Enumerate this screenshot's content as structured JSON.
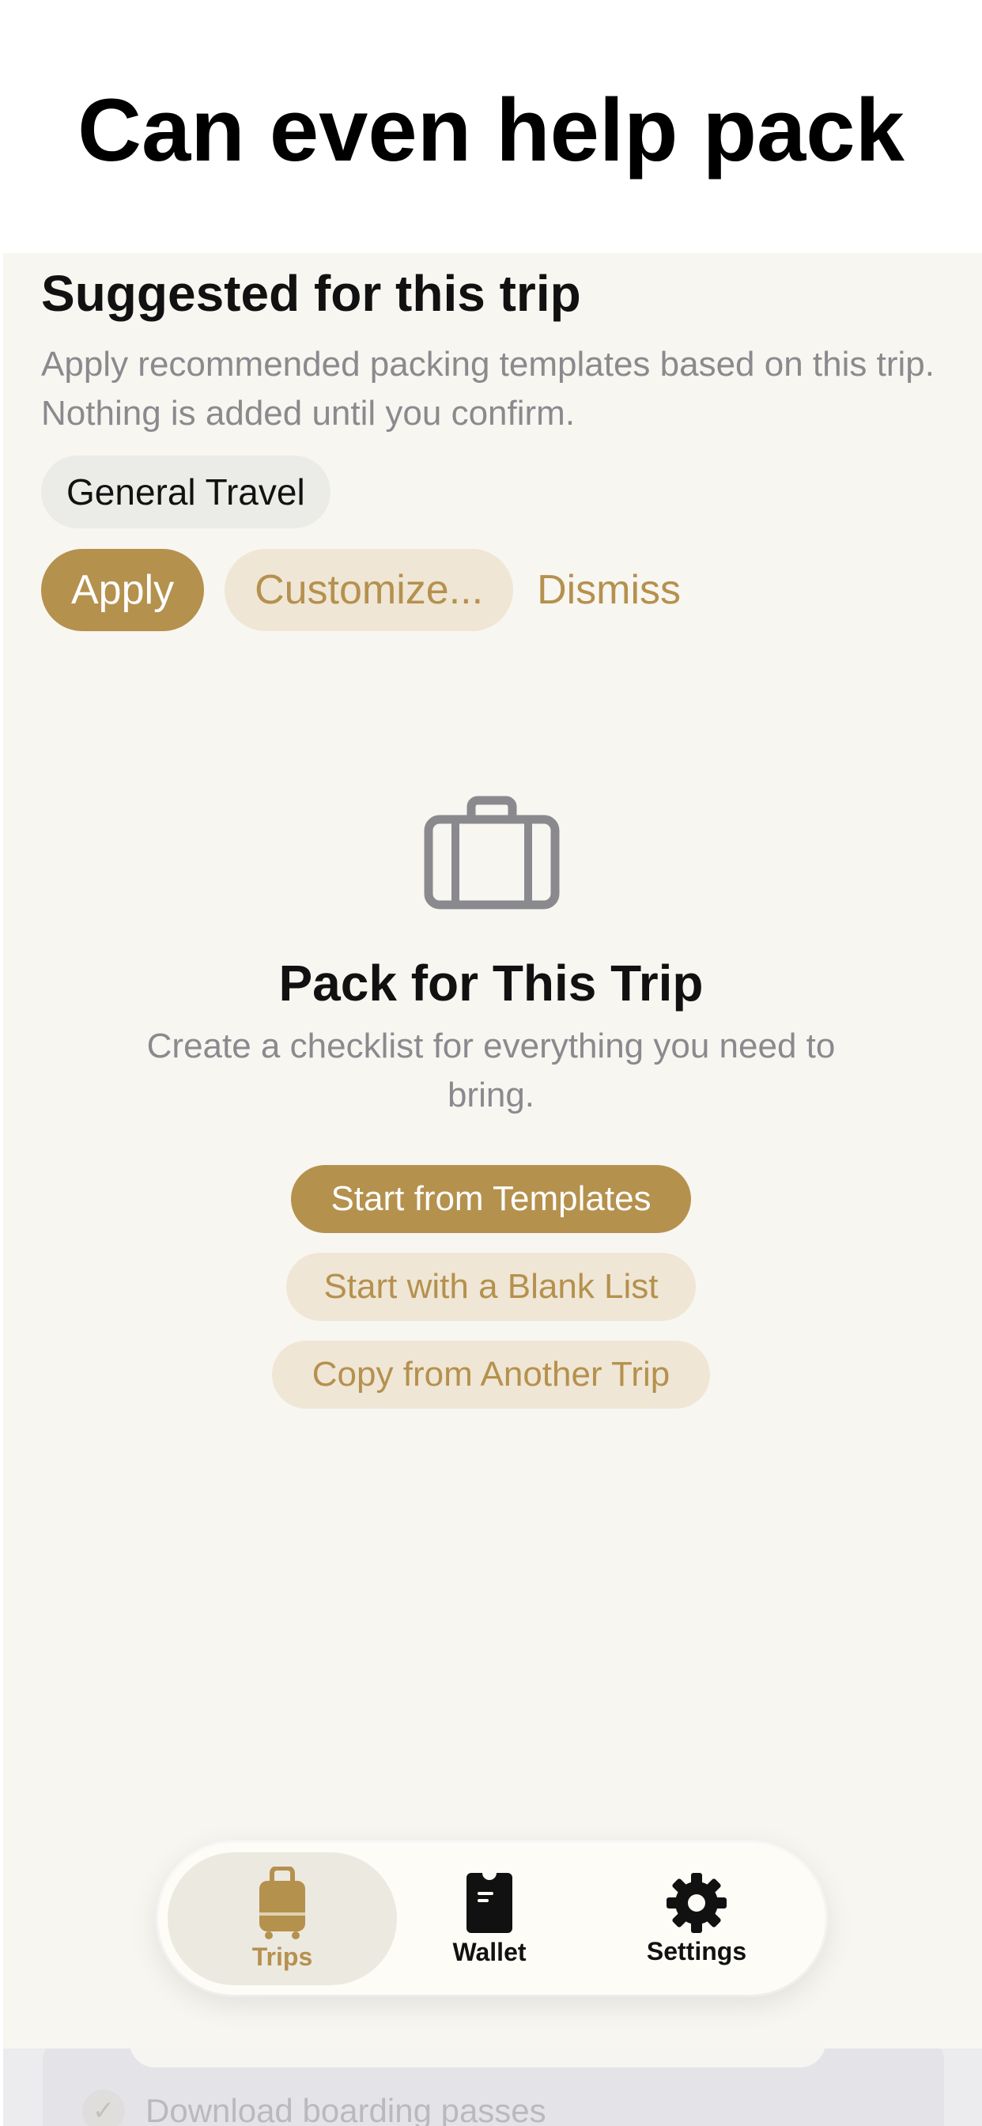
{
  "marketing": {
    "title": "Can even help pack"
  },
  "suggested": {
    "title": "Suggested for this trip",
    "description": "Apply recommended packing templates based on this trip. Nothing is added until you confirm.",
    "chip": "General Travel",
    "actions": {
      "apply": "Apply",
      "customize": "Customize...",
      "dismiss": "Dismiss"
    }
  },
  "empty_state": {
    "icon": "suitcase-icon",
    "title": "Pack for This Trip",
    "description": "Create a checklist for everything you need to bring.",
    "buttons": {
      "templates": "Start from Templates",
      "blank": "Start with a Blank List",
      "copy": "Copy from Another Trip"
    }
  },
  "tabbar": {
    "items": [
      {
        "label": "Trips",
        "icon": "luggage-icon",
        "active": true
      },
      {
        "label": "Wallet",
        "icon": "wallet-pass-icon",
        "active": false
      },
      {
        "label": "Settings",
        "icon": "gear-icon",
        "active": false
      }
    ]
  },
  "background_peek": {
    "item": "Download boarding passes"
  },
  "colors": {
    "accent": "#b5914e",
    "accent_soft": "#efe6d5",
    "background": "#f8f6f1",
    "text_primary": "#111111",
    "text_secondary": "#8a8a8e"
  }
}
